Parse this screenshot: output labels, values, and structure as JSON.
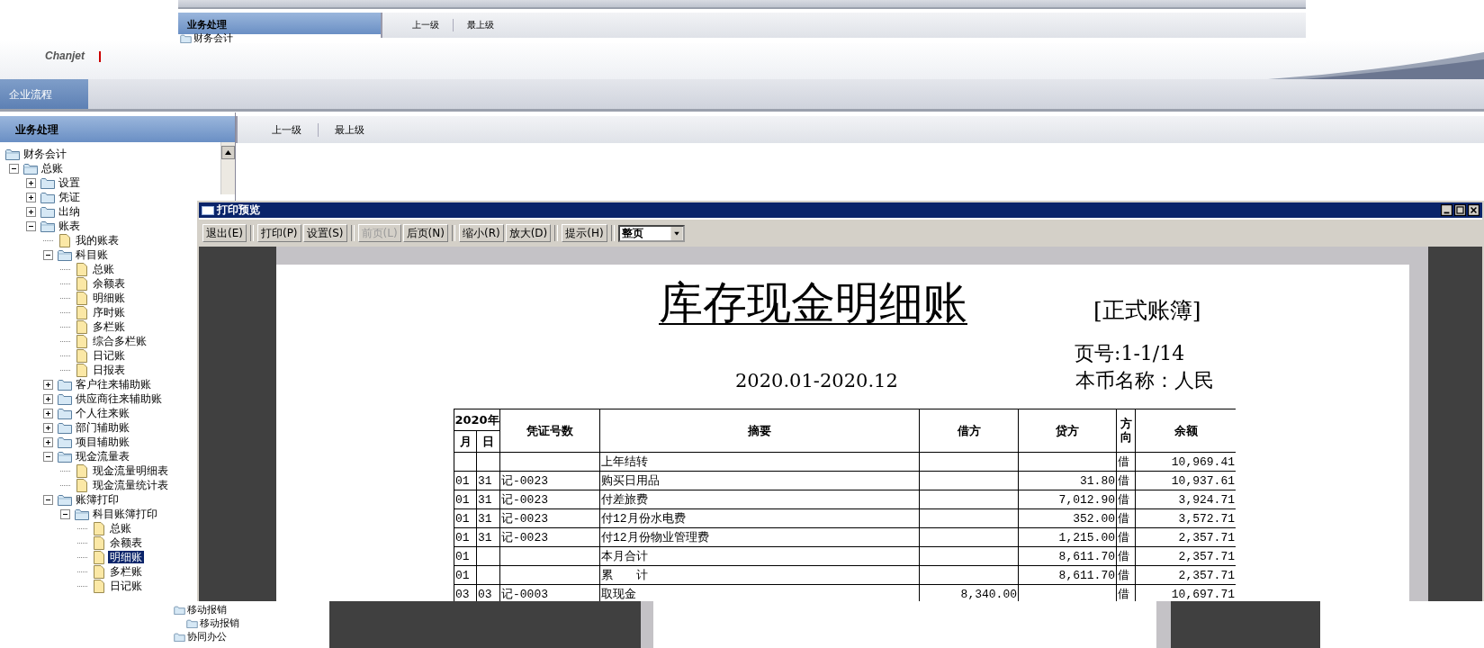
{
  "ghost_top": {
    "sidebar_title": "业务处理",
    "tree_item": "财务会计",
    "breadcrumbs": [
      "上一级",
      "最上级"
    ]
  },
  "brand": {
    "logo": "Chanjet"
  },
  "tabs": [
    {
      "label": "企业流程",
      "selected": true
    }
  ],
  "sidebar": {
    "title": "业务处理",
    "tree": [
      {
        "label": "财务会计",
        "kind": "folder",
        "expanded": true,
        "selected": false,
        "children": [
          {
            "label": "总账",
            "kind": "folder",
            "expanded": true,
            "selected": false,
            "children": [
              {
                "label": "设置",
                "kind": "folder",
                "expanded": false,
                "selected": false
              },
              {
                "label": "凭证",
                "kind": "folder",
                "expanded": false,
                "selected": false
              },
              {
                "label": "出纳",
                "kind": "folder",
                "expanded": false,
                "selected": false
              },
              {
                "label": "账表",
                "kind": "folder",
                "expanded": true,
                "selected": false,
                "children": [
                  {
                    "label": "我的账表",
                    "kind": "document",
                    "selected": false
                  },
                  {
                    "label": "科目账",
                    "kind": "folder",
                    "expanded": true,
                    "selected": false,
                    "children": [
                      {
                        "label": "总账",
                        "kind": "document",
                        "selected": false
                      },
                      {
                        "label": "余额表",
                        "kind": "document",
                        "selected": false
                      },
                      {
                        "label": "明细账",
                        "kind": "document",
                        "selected": false
                      },
                      {
                        "label": "序时账",
                        "kind": "document",
                        "selected": false
                      },
                      {
                        "label": "多栏账",
                        "kind": "document",
                        "selected": false
                      },
                      {
                        "label": "综合多栏账",
                        "kind": "document",
                        "selected": false
                      },
                      {
                        "label": "日记账",
                        "kind": "document",
                        "selected": false
                      },
                      {
                        "label": "日报表",
                        "kind": "document",
                        "selected": false
                      }
                    ]
                  },
                  {
                    "label": "客户往来辅助账",
                    "kind": "folder",
                    "expanded": false,
                    "selected": false
                  },
                  {
                    "label": "供应商往来辅助账",
                    "kind": "folder",
                    "expanded": false,
                    "selected": false
                  },
                  {
                    "label": "个人往来账",
                    "kind": "folder",
                    "expanded": false,
                    "selected": false
                  },
                  {
                    "label": "部门辅助账",
                    "kind": "folder",
                    "expanded": false,
                    "selected": false
                  },
                  {
                    "label": "项目辅助账",
                    "kind": "folder",
                    "expanded": false,
                    "selected": false
                  },
                  {
                    "label": "现金流量表",
                    "kind": "folder",
                    "expanded": true,
                    "selected": false,
                    "children": [
                      {
                        "label": "现金流量明细表",
                        "kind": "document",
                        "selected": false
                      },
                      {
                        "label": "现金流量统计表",
                        "kind": "document",
                        "selected": false
                      }
                    ]
                  },
                  {
                    "label": "账簿打印",
                    "kind": "folder",
                    "expanded": true,
                    "selected": false,
                    "children": [
                      {
                        "label": "科目账簿打印",
                        "kind": "folder",
                        "expanded": true,
                        "selected": false,
                        "children": [
                          {
                            "label": "总账",
                            "kind": "document",
                            "selected": false
                          },
                          {
                            "label": "余额表",
                            "kind": "document",
                            "selected": false
                          },
                          {
                            "label": "明细账",
                            "kind": "document",
                            "selected": true
                          },
                          {
                            "label": "多栏账",
                            "kind": "document",
                            "selected": false
                          },
                          {
                            "label": "日记账",
                            "kind": "document",
                            "selected": false
                          }
                        ]
                      }
                    ]
                  }
                ]
              }
            ]
          }
        ]
      }
    ]
  },
  "breadcrumbs": [
    "上一级",
    "最上级"
  ],
  "preview": {
    "title": "打印预览",
    "toolbar": [
      {
        "buttons": [
          {
            "label": "退出(E)",
            "disabled": false
          }
        ]
      },
      {
        "buttons": [
          {
            "label": "打印(P)",
            "disabled": false
          },
          {
            "label": "设置(S)",
            "disabled": false
          }
        ]
      },
      {
        "buttons": [
          {
            "label": "前页(L)",
            "disabled": true
          },
          {
            "label": "后页(N)",
            "disabled": false
          }
        ]
      },
      {
        "buttons": [
          {
            "label": "缩小(R)",
            "disabled": false
          },
          {
            "label": "放大(D)",
            "disabled": false
          }
        ]
      },
      {
        "buttons": [
          {
            "label": "提示(H)",
            "disabled": false
          }
        ]
      }
    ],
    "zoom_select": "整页",
    "report": {
      "title": "库存现金明细账",
      "badge": "[正式账簿]",
      "page_no": "页号:1-1/14",
      "period": "2020.01-2020.12",
      "currency": "本币名称：人民",
      "header": {
        "year": "2020年",
        "month": "月",
        "day": "日",
        "voucher": "凭证号数",
        "summary": "摘要",
        "debit": "借方",
        "credit": "贷方",
        "direction": "方向",
        "balance": "余额"
      },
      "rows": [
        {
          "summary": "上年结转",
          "direction": "借",
          "balance": "10,969.41"
        },
        {
          "month": "01",
          "day": "31",
          "voucher": "记-0023",
          "summary": "购买日用品",
          "credit": "31.80",
          "direction": "借",
          "balance": "10,937.61"
        },
        {
          "month": "01",
          "day": "31",
          "voucher": "记-0023",
          "summary": "付差旅费",
          "credit": "7,012.90",
          "direction": "借",
          "balance": "3,924.71"
        },
        {
          "month": "01",
          "day": "31",
          "voucher": "记-0023",
          "summary": "付12月份水电费",
          "credit": "352.00",
          "direction": "借",
          "balance": "3,572.71"
        },
        {
          "month": "01",
          "day": "31",
          "voucher": "记-0023",
          "summary": "付12月份物业管理费",
          "credit": "1,215.00",
          "direction": "借",
          "balance": "2,357.71"
        },
        {
          "month": "01",
          "summary": "本月合计",
          "credit": "8,611.70",
          "direction": "借",
          "balance": "2,357.71"
        },
        {
          "month": "01",
          "summary": "累　　计",
          "credit": "8,611.70",
          "direction": "借",
          "balance": "2,357.71"
        },
        {
          "month": "03",
          "day": "03",
          "voucher": "记-0003",
          "summary": "取现金",
          "debit": "8,340.00",
          "direction": "借",
          "balance": "10,697.71"
        }
      ]
    }
  },
  "ghost_bottom": {
    "tree": [
      {
        "label": "移动报销",
        "children": [
          {
            "label": "移动报销"
          }
        ]
      },
      {
        "label": "协同办公"
      }
    ]
  }
}
